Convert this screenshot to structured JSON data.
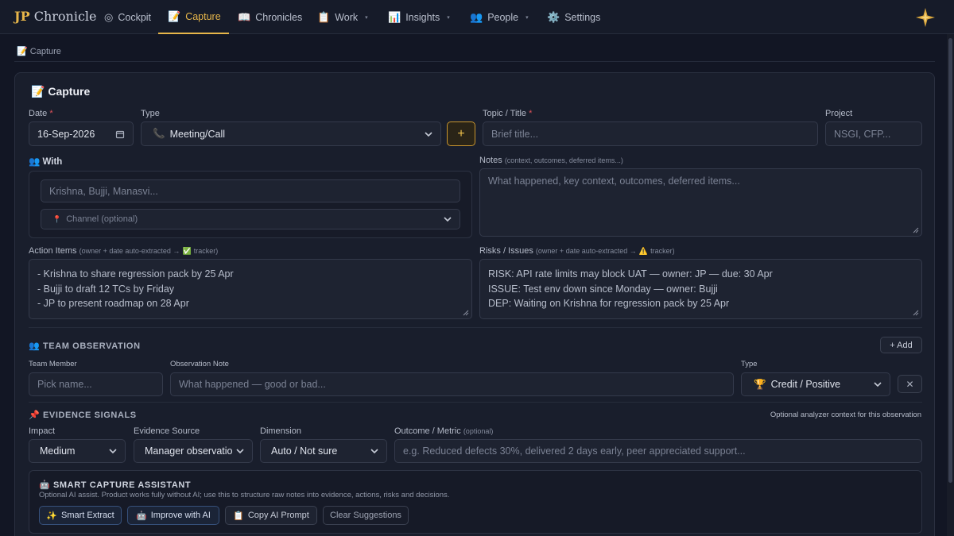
{
  "app": {
    "logo_mark": "JP",
    "logo_text": "Chronicle"
  },
  "nav": [
    {
      "label": "Cockpit",
      "icon": "◎"
    },
    {
      "label": "Capture",
      "icon": "📝"
    },
    {
      "label": "Chronicles",
      "icon": "📖"
    },
    {
      "label": "Work",
      "icon": "📋",
      "caret": "▾"
    },
    {
      "label": "Insights",
      "icon": "📊",
      "caret": "▾"
    },
    {
      "label": "People",
      "icon": "👥",
      "caret": "▾"
    },
    {
      "label": "Settings",
      "icon": "⚙️"
    }
  ],
  "breadcrumb": {
    "icon": "📝",
    "label": "Capture"
  },
  "form": {
    "title": "Capture",
    "title_icon": "📝",
    "date": {
      "label": "Date",
      "required": "*",
      "value": "16-Sep-2026"
    },
    "type": {
      "label": "Type",
      "icon": "📞",
      "value": "Meeting/Call"
    },
    "add_button": "+",
    "topic": {
      "label": "Topic / Title",
      "required": "*",
      "placeholder": "Brief title..."
    },
    "project": {
      "label": "Project",
      "placeholder": "NSGI, CFP..."
    },
    "with": {
      "label": "With",
      "icon": "👥",
      "placeholder": "Krishna, Bujji, Manasvi...",
      "channel_icon": "📍",
      "channel": "Channel (optional)"
    },
    "notes": {
      "label": "Notes",
      "hint": "(context, outcomes, deferred items...)",
      "placeholder": "What happened, key context, outcomes, deferred items..."
    },
    "action_items": {
      "label": "Action Items",
      "hint": "(owner + date auto-extracted →",
      "hint_icon": "✅",
      "hint_end": "tracker)",
      "placeholder": [
        "- Krishna to share regression pack by 25 Apr",
        "- Bujji to draft 12 TCs by Friday",
        "- JP to present roadmap on 28 Apr"
      ]
    },
    "risks": {
      "label": "Risks / Issues",
      "hint": "(owner + date auto-extracted →",
      "hint_icon": "⚠️",
      "hint_end": "tracker)",
      "placeholder": [
        "RISK: API rate limits may block UAT — owner: JP — due: 30 Apr",
        "ISSUE: Test env down since Monday — owner: Bujji",
        "DEP: Waiting on Krishna for regression pack by 25 Apr"
      ]
    }
  },
  "team_observation": {
    "title": "TEAM OBSERVATION",
    "icon": "👥",
    "add_button": "+ Add",
    "member": {
      "label": "Team Member",
      "placeholder": "Pick name..."
    },
    "note": {
      "label": "Observation Note",
      "placeholder": "What happened — good or bad..."
    },
    "type": {
      "label": "Type",
      "icon": "🏆",
      "value": "Credit / Positive"
    },
    "remove_button": "✕"
  },
  "evidence": {
    "title": "EVIDENCE SIGNALS",
    "icon": "📌",
    "hint": "Optional analyzer context for this observation",
    "impact": {
      "label": "Impact",
      "value": "Medium"
    },
    "source": {
      "label": "Evidence Source",
      "value": "Manager observation"
    },
    "dimension": {
      "label": "Dimension",
      "value": "Auto / Not sure"
    },
    "outcome": {
      "label": "Outcome / Metric",
      "hint": "(optional)",
      "placeholder": "e.g. Reduced defects 30%, delivered 2 days early, peer appreciated support..."
    }
  },
  "assistant": {
    "title": "SMART CAPTURE ASSISTANT",
    "icon": "🤖",
    "desc": "Optional AI assist. Product works fully without AI; use this to structure raw notes into evidence, actions, risks and decisions.",
    "buttons": [
      {
        "icon": "✨",
        "label": "Smart Extract"
      },
      {
        "icon": "🤖",
        "label": "Improve with AI"
      },
      {
        "icon": "📋",
        "label": "Copy AI Prompt"
      },
      {
        "icon": "",
        "label": "Clear Suggestions"
      }
    ]
  }
}
